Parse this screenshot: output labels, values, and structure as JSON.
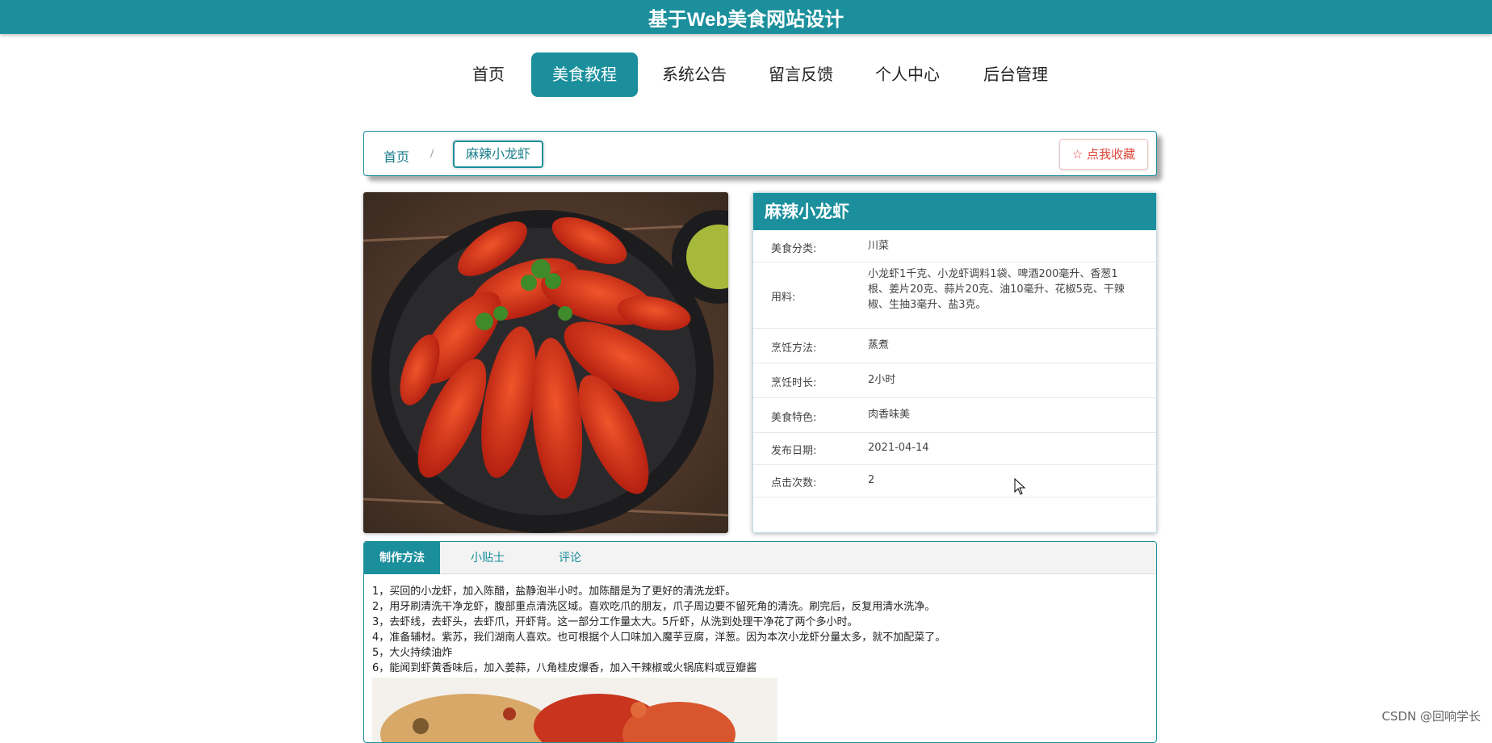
{
  "site": {
    "title": "基于Web美食网站设计"
  },
  "nav": {
    "items": [
      {
        "label": "首页"
      },
      {
        "label": "美食教程"
      },
      {
        "label": "系统公告"
      },
      {
        "label": "留言反馈"
      },
      {
        "label": "个人中心"
      },
      {
        "label": "后台管理"
      }
    ],
    "active": "美食教程"
  },
  "breadcrumb": {
    "home": "首页",
    "separator": "/",
    "current": "麻辣小龙虾"
  },
  "favorite_button": {
    "icon": "star-outline-icon",
    "label": "☆ 点我收藏"
  },
  "detail": {
    "title": "麻辣小龙虾",
    "rows": [
      {
        "key": "美食分类:",
        "value": "川菜"
      },
      {
        "key": "用料:",
        "value": "小龙虾1千克、小龙虾调料1袋、啤酒200毫升、香葱1根、姜片20克、蒜片20克、油10毫升、花椒5克、干辣椒、生抽3毫升、盐3克。"
      },
      {
        "key": "烹饪方法:",
        "value": "蒸煮"
      },
      {
        "key": "烹饪时长:",
        "value": "2小时"
      },
      {
        "key": "美食特色:",
        "value": "肉香味美"
      },
      {
        "key": "发布日期:",
        "value": "2021-04-14"
      },
      {
        "key": "点击次数:",
        "value": "2"
      }
    ]
  },
  "tabs": [
    {
      "label": "制作方法"
    },
    {
      "label": "小贴士"
    },
    {
      "label": "评论"
    }
  ],
  "steps": [
    "1，买回的小龙虾，加入陈醋，盐静泡半小时。加陈醋是为了更好的清洗龙虾。",
    "2，用牙刷清洗干净龙虾，腹部重点清洗区域。喜欢吃爪的朋友，爪子周边要不留死角的清洗。刷完后，反复用清水洗净。",
    "3，去虾线，去虾头，去虾爪，开虾背。这一部分工作量太大。5斤虾，从洗到处理干净花了两个多小时。",
    "4，准备辅材。紫苏，我们湖南人喜欢。也可根据个人口味加入魔芋豆腐，洋葱。因为本次小龙虾分量太多，就不加配菜了。",
    "5，大火持续油炸",
    "6，能闻到虾黄香味后，加入姜蒜，八角桂皮爆香，加入干辣椒或火锅底料或豆瓣酱"
  ],
  "watermark": "CSDN @回响学长",
  "colors": {
    "primary": "#1b8f9c",
    "favorite": "#e0473c"
  }
}
